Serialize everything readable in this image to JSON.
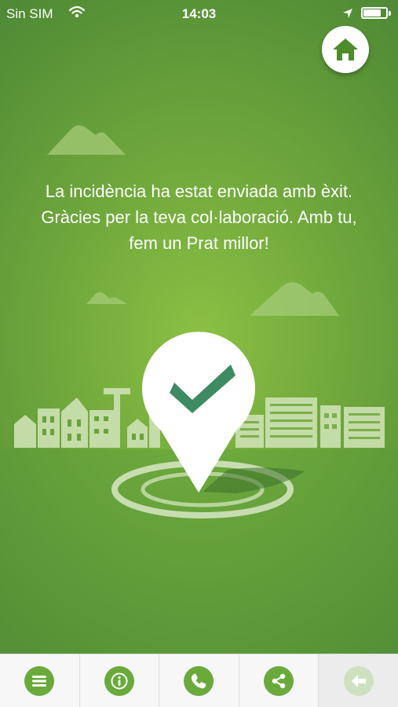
{
  "status_bar": {
    "carrier": "Sin SIM",
    "time": "14:03",
    "battery_level": 0.8,
    "icons": [
      "wifi-icon",
      "location-arrow-icon",
      "battery-icon"
    ]
  },
  "home_button": {
    "icon": "home-icon"
  },
  "message": {
    "line1": "La incidència ha estat enviada amb èxit.",
    "line2": "Gràcies per la teva col·laboració. Amb tu,",
    "line3": "fem un Prat millor!"
  },
  "illustration": {
    "icon": "map-pin-checkmark-icon"
  },
  "colors": {
    "background": "#6fa73c",
    "accent": "#6aaa3c",
    "check": "#3e8b63",
    "disabled": "#cde0c0"
  },
  "tab_bar": [
    {
      "icon": "menu-icon",
      "enabled": true
    },
    {
      "icon": "info-icon",
      "enabled": true
    },
    {
      "icon": "phone-icon",
      "enabled": true
    },
    {
      "icon": "share-icon",
      "enabled": true
    },
    {
      "icon": "back-arrow-icon",
      "enabled": false
    }
  ]
}
